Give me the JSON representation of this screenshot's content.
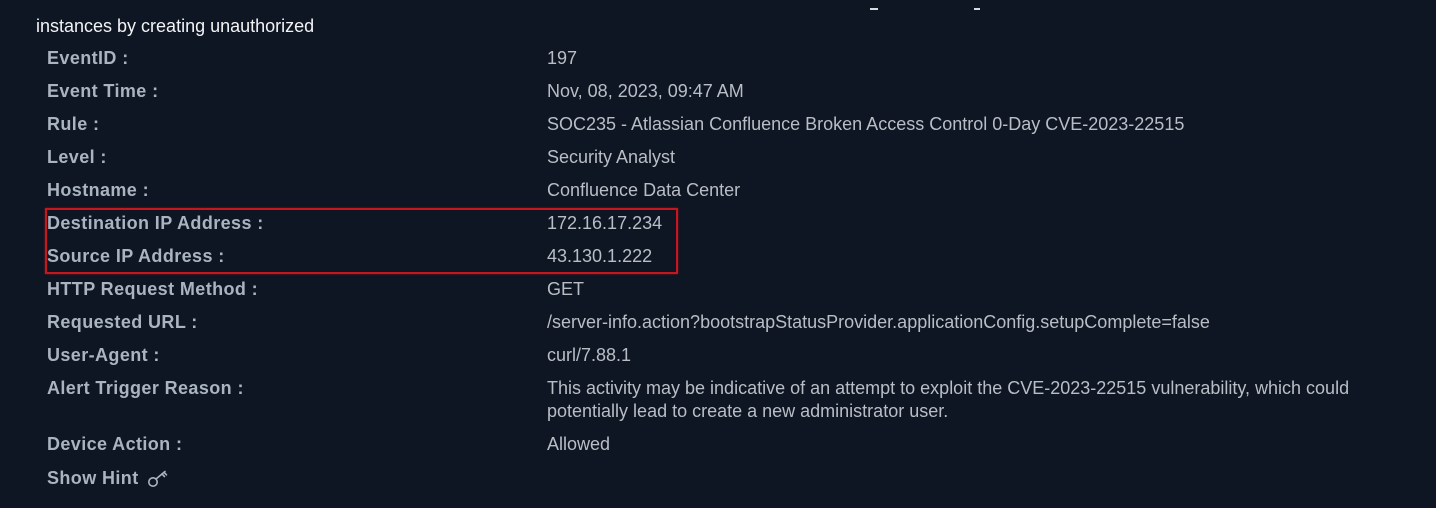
{
  "intro_text": "instances by creating unauthorized",
  "fields": [
    {
      "label": "EventID :",
      "value": "197"
    },
    {
      "label": "Event Time :",
      "value": "Nov, 08, 2023, 09:47 AM"
    },
    {
      "label": "Rule :",
      "value": "SOC235 - Atlassian Confluence Broken Access Control 0-Day CVE-2023-22515"
    },
    {
      "label": "Level :",
      "value": "Security Analyst"
    },
    {
      "label": "Hostname :",
      "value": "Confluence Data Center"
    },
    {
      "label": "Destination IP Address :",
      "value": "172.16.17.234"
    },
    {
      "label": "Source IP Address :",
      "value": "43.130.1.222"
    },
    {
      "label": "HTTP Request Method :",
      "value": "GET"
    },
    {
      "label": "Requested URL :",
      "value": "/server-info.action?bootstrapStatusProvider.applicationConfig.setupComplete=false"
    },
    {
      "label": "User-Agent :",
      "value": "curl/7.88.1"
    },
    {
      "label": "Alert Trigger Reason :",
      "value": "This activity may be indicative of an attempt to exploit the CVE-2023-22515 vulnerability, which could potentially lead to create a new administrator user."
    },
    {
      "label": "Device Action :",
      "value": "Allowed"
    }
  ],
  "hint": {
    "label": "Show Hint",
    "icon": "key-icon"
  },
  "colors": {
    "background": "#0e1623",
    "label": "#aab3c0",
    "value": "#b9bec6",
    "highlight_border": "#c8161e"
  }
}
